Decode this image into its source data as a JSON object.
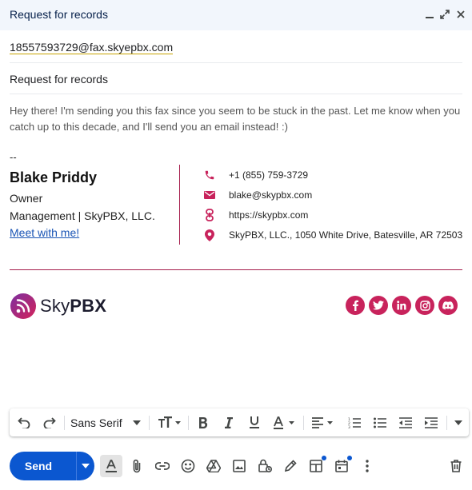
{
  "window": {
    "title": "Request for records",
    "minimize_icon": "minimize-icon",
    "expand_icon": "expand-icon",
    "close_icon": "close-icon"
  },
  "compose": {
    "to": "18557593729@fax.skyepbx.com",
    "subject": "Request for records",
    "body": "Hey there! I'm sending you this fax since you seem to be stuck in the past. Let me know when you catch up to this decade, and I'll send you an email instead! :)"
  },
  "signature": {
    "dash": "--",
    "name": "Blake Priddy",
    "role": "Owner",
    "company": "Management | SkyPBX, LLC.",
    "meeting_link": "Meet with me!",
    "phone": "+1 (855) 759-3729",
    "email": "blake@skypbx.com",
    "website": "https://skypbx.com",
    "address": "SkyPBX, LLC., 1050 White Drive, Batesville, AR 72503",
    "logo_light": "Sky",
    "logo_bold": "PBX",
    "socials": [
      "facebook-icon",
      "twitter-icon",
      "linkedin-icon",
      "instagram-icon",
      "discord-icon"
    ],
    "accent_color": "#c8235c"
  },
  "toolbar": {
    "font_family": "Sans Serif"
  },
  "actions": {
    "send_label": "Send",
    "send_color": "#0b57d0"
  }
}
